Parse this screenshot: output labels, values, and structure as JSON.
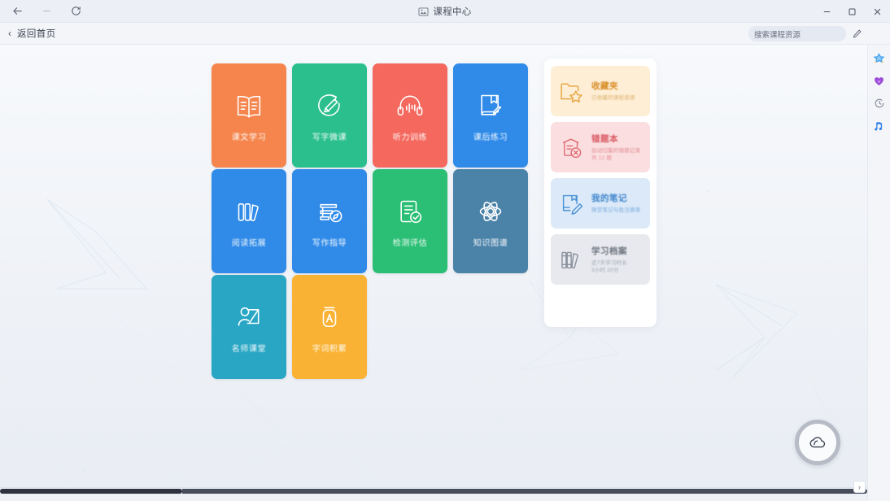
{
  "window": {
    "title": "课程中心",
    "controls": {
      "minimize": "—",
      "maximize": "❐",
      "close": "✕"
    },
    "nav": {
      "back": "back-arrow",
      "forward": "forward-arrow",
      "reload": "reload"
    }
  },
  "subheader": {
    "back_label": "返回首页",
    "chevron": "‹",
    "search_value": "搜索课程资源",
    "edit_label": "edit"
  },
  "rail": {
    "items": [
      {
        "name": "scan-frame-icon",
        "color": "#2f7fe8"
      },
      {
        "name": "star-node-icon",
        "color": "#3aa0f0"
      },
      {
        "name": "heart-diamond-icon",
        "color": "#9b4bd8"
      },
      {
        "name": "clock-icon",
        "color": "#7b8190"
      },
      {
        "name": "music-note-icon",
        "color": "#2f7fe8"
      }
    ]
  },
  "tiles": [
    {
      "label": "课文学习",
      "color": "#f5854d",
      "icon": "open-book-icon"
    },
    {
      "label": "写字微课",
      "color": "#2abf8c",
      "icon": "pencil-circle-icon"
    },
    {
      "label": "听力训练",
      "color": "#f4685e",
      "icon": "headphones-wave-icon"
    },
    {
      "label": "课后练习",
      "color": "#2f8ae8",
      "icon": "book-pen-icon"
    },
    {
      "label": "阅读拓展",
      "color": "#2f8ae8",
      "icon": "books-shelf-icon"
    },
    {
      "label": "写作指导",
      "color": "#2f8ae8",
      "icon": "books-compass-icon"
    },
    {
      "label": "检测评估",
      "color": "#2abf74",
      "icon": "doc-check-icon"
    },
    {
      "label": "知识图谱",
      "color": "#4b82a8",
      "icon": "atom-icon"
    },
    {
      "label": "名师课堂",
      "color": "#29a6c4",
      "icon": "teacher-board-icon"
    },
    {
      "label": "字词积累",
      "color": "#f9b233",
      "icon": "letter-a-jar-icon"
    }
  ],
  "panel": {
    "cards": [
      {
        "title": "收藏夹",
        "sub": "已收藏的课程资源",
        "bg": "#fdeed5",
        "accent": "#e8a33c",
        "icon": "folder-star-icon"
      },
      {
        "title": "错题本",
        "sub": "自动归集的错题记录\n共 12 题",
        "bg": "#fbdfe0",
        "accent": "#e06a72",
        "icon": "doc-error-icon"
      },
      {
        "title": "我的笔记",
        "sub": "随堂笔记与批注摘录",
        "bg": "#dbe9f8",
        "accent": "#4a92d6",
        "icon": "book-pencil-icon"
      },
      {
        "title": "学习档案",
        "sub": "近7天学习时长\n3小时 20分",
        "bg": "#e7e9ee",
        "accent": "#8a909c",
        "icon": "books-gray-icon"
      }
    ]
  },
  "fab": {
    "name": "cloud-sync-button",
    "icon": "cloud-icon"
  },
  "scrollbar": {
    "next": "›"
  }
}
